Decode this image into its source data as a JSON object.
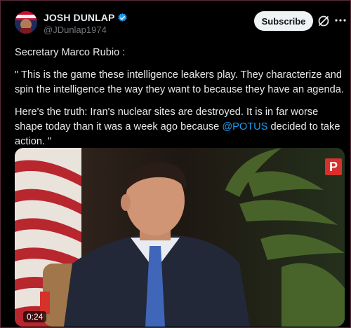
{
  "author": {
    "display_name": "JOSH DUNLAP",
    "handle": "@JDunlap1974",
    "verified": true
  },
  "actions": {
    "subscribe_label": "Subscribe",
    "grok_icon": "grok-slash-icon",
    "more_icon": "more-options-icon"
  },
  "post": {
    "line1": "Secretary Marco Rubio :",
    "line2": "\" This is the game these intelligence leakers play. They characterize and spin the intelligence the way they want to because they have an agenda.",
    "line3_before": "Here's the truth: Iran's nuclear sites are destroyed. It is in far worse shape today than it was a week ago because ",
    "mention": "@POTUS",
    "line3_after": " decided to take action. \""
  },
  "media": {
    "logo_letter": "P",
    "duration": "0:24"
  },
  "colors": {
    "accent": "#1d9bf0",
    "verified": "#1d9bf0",
    "logo": "#d6312b"
  }
}
